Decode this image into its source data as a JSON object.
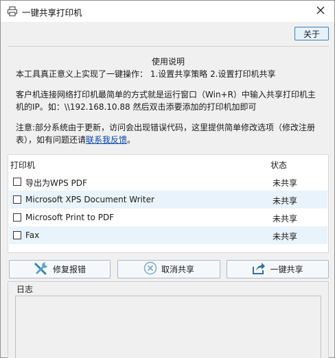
{
  "window": {
    "title": "一键共享打印机",
    "about_label": "关于"
  },
  "usage": {
    "title": "使用说明",
    "line1": "本工具真正意义上实现了一键操作：  1.设置共享策略 2.设置打印机共享",
    "line2": "客户机连接网络打印机最简单的方式就是运行窗口（Win+R）中输入共享打印机主",
    "line3": "机的IP。如：\\\\192.168.10.88 然后双击添要添加的打印机加即可",
    "line4": "注意:部分系统由于更新，访问会出现错误代码，这里提供简单修改选项（修改注册",
    "line5_prefix": "表），如有问题还请",
    "line5_link": "联系我反馈",
    "line5_suffix": "。"
  },
  "printers": {
    "header_name": "打印机",
    "header_status": "状态",
    "rows": [
      {
        "name": "导出为WPS PDF",
        "status": "未共享",
        "checked": false
      },
      {
        "name": "Microsoft XPS Document Writer",
        "status": "未共享",
        "checked": false
      },
      {
        "name": "Microsoft Print to PDF",
        "status": "未共享",
        "checked": false
      },
      {
        "name": "Fax",
        "status": "未共享",
        "checked": false
      }
    ]
  },
  "actions": {
    "repair_label": "修复报错",
    "cancel_label": "取消共享",
    "share_label": "一键共享"
  },
  "log": {
    "label": "日志",
    "content": ""
  },
  "colors": {
    "accent": "#3c7fb1",
    "row_alt": "#e9f3fb",
    "link": "#0645ad"
  }
}
